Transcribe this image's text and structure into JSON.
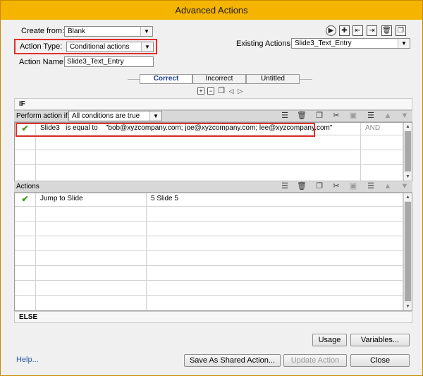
{
  "title": "Advanced Actions",
  "create_from": {
    "label": "Create from:",
    "value": "Blank"
  },
  "action_type": {
    "label": "Action Type:",
    "value": "Conditional actions"
  },
  "action_name": {
    "label": "Action Name:",
    "value": "Slide3_Text_Entry"
  },
  "existing_actions": {
    "label": "Existing Actions:",
    "value": "Slide3_Text_Entry"
  },
  "toolbar_icons": [
    "play-icon",
    "add-icon",
    "import-icon",
    "export-icon",
    "delete-icon",
    "duplicate-icon"
  ],
  "tabs": [
    {
      "label": "Correct",
      "active": true
    },
    {
      "label": "Incorrect",
      "active": false
    },
    {
      "label": "Untitled",
      "active": false
    }
  ],
  "if_section": {
    "label": "IF",
    "perform_label": "Perform action if:",
    "perform_value": "All conditions are true",
    "condition": {
      "variable": "Slide3",
      "operator": "is equal to",
      "value": "\"bob@xyzcompany.com; joe@xyzcompany.com; lee@xyzcompany.com\"",
      "logic": "AND"
    }
  },
  "actions_section": {
    "label": "Actions",
    "action": {
      "name": "Jump to Slide",
      "target": "5 Slide 5"
    }
  },
  "else_label": "ELSE",
  "buttons": {
    "usage": "Usage",
    "variables": "Variables...",
    "save_shared": "Save As Shared Action...",
    "update": "Update Action",
    "close": "Close"
  },
  "help": "Help...",
  "colors": {
    "titlebar": "#f5b400",
    "highlight": "#e0302b",
    "check": "#3a9a16"
  }
}
